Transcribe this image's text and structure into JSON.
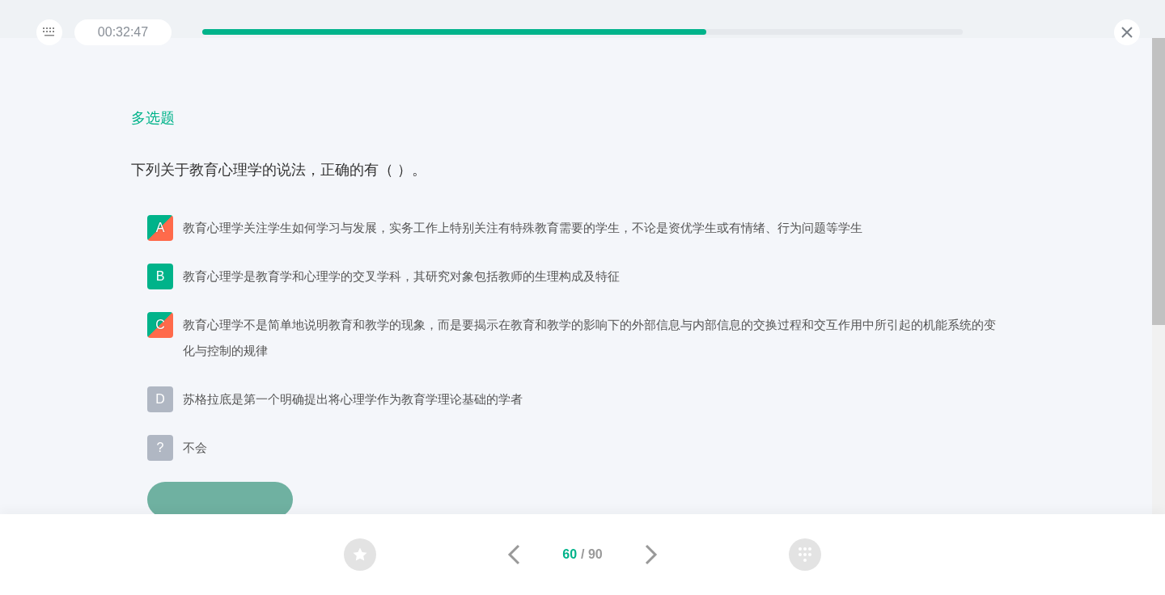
{
  "top_bar": {
    "timer": "00:32:47",
    "progress": {
      "level": 0.663
    }
  },
  "question": {
    "type_label": "多选题",
    "stem": "下列关于教育心理学的说法，正确的有（   ）。",
    "options": [
      {
        "letter": "A",
        "text": "教育心理学关注学生如何学习与发展，实务工作上特别关注有特殊教育需要的学生，不论是资优学生或有情绪、行为问题等学生",
        "kind": "split"
      },
      {
        "letter": "B",
        "text": "教育心理学是教育学和心理学的交叉学科，其研究对象包括教师的生理构成及特征",
        "kind": "correct"
      },
      {
        "letter": "C",
        "text": "教育心理学不是简单地说明教育和教学的现象，而是要揭示在教育和教学的影响下的外部信息与内部信息的交换过程和交互作用中所引起的机能系统的变化与控制的规律",
        "kind": "split"
      },
      {
        "letter": "D",
        "text": "苏格拉底是第一个明确提出将心理学作为教育学理论基础的学者",
        "kind": "plain"
      },
      {
        "letter": "?",
        "text": "不会",
        "kind": "plain"
      }
    ]
  },
  "footer": {
    "current": "60",
    "total": "/ 90"
  }
}
